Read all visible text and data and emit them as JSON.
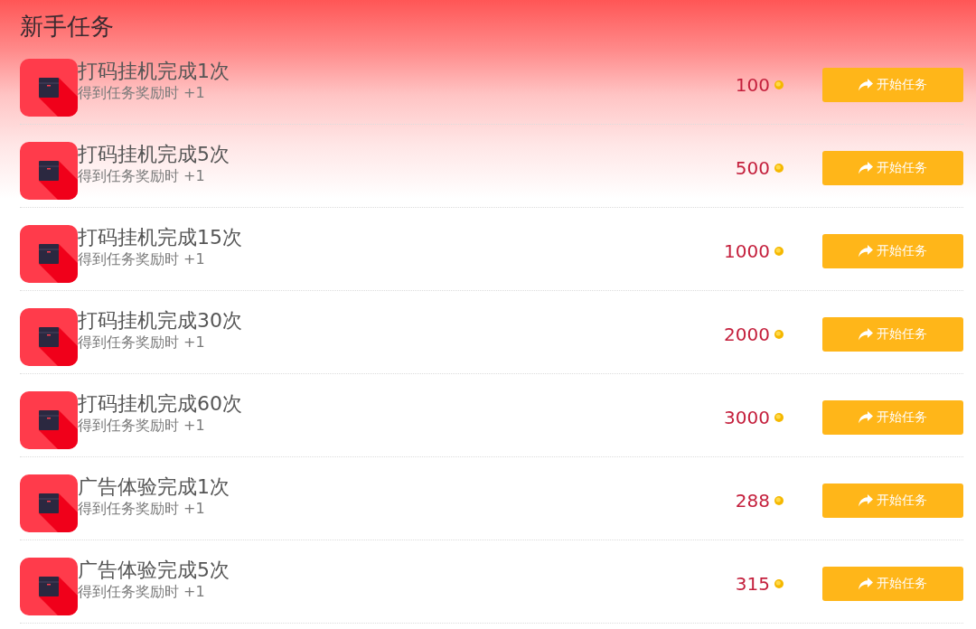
{
  "header": {
    "title": "新手任务"
  },
  "tasks": [
    {
      "title": "打码挂机完成1次",
      "subtitle": "得到任务奖励时 +1",
      "points": "100",
      "button": "开始任务"
    },
    {
      "title": "打码挂机完成5次",
      "subtitle": "得到任务奖励时 +1",
      "points": "500",
      "button": "开始任务"
    },
    {
      "title": "打码挂机完成15次",
      "subtitle": "得到任务奖励时 +1",
      "points": "1000",
      "button": "开始任务"
    },
    {
      "title": "打码挂机完成30次",
      "subtitle": "得到任务奖励时 +1",
      "points": "2000",
      "button": "开始任务"
    },
    {
      "title": "打码挂机完成60次",
      "subtitle": "得到任务奖励时 +1",
      "points": "3000",
      "button": "开始任务"
    },
    {
      "title": "广告体验完成1次",
      "subtitle": "得到任务奖励时 +1",
      "points": "288",
      "button": "开始任务"
    },
    {
      "title": "广告体验完成5次",
      "subtitle": "得到任务奖励时 +1",
      "points": "315",
      "button": "开始任务"
    }
  ]
}
